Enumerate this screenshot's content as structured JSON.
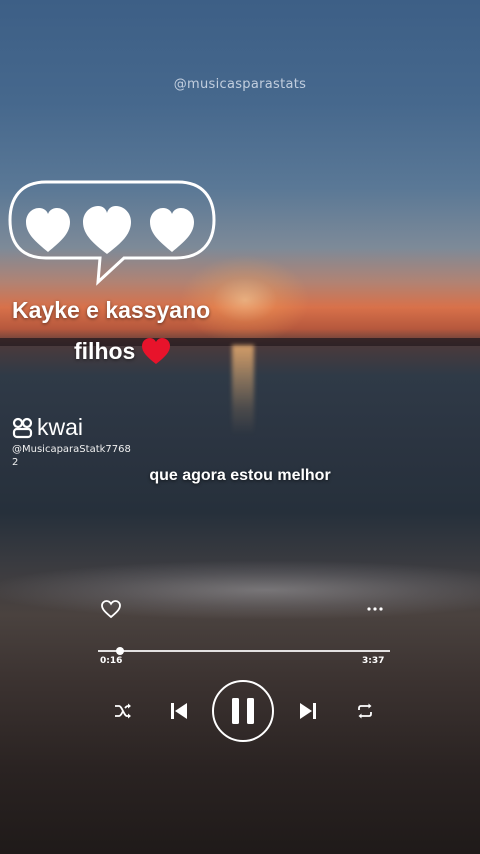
{
  "watermark": "@musicasparastats",
  "overlay": {
    "caption_line1": "Kayke e kassyano",
    "caption_line2": "filhos",
    "bubble_hearts": 3
  },
  "branding": {
    "logo_text": "kwai",
    "handle": "@MusicaparaStatk77682"
  },
  "lyric": "que agora estou melhor",
  "player": {
    "current_time": "0:16",
    "total_time": "3:37",
    "progress": 0.074,
    "state": "playing"
  },
  "icons": [
    "heart-icon",
    "more-icon",
    "shuffle-icon",
    "previous-icon",
    "pause-icon",
    "next-icon",
    "repeat-icon"
  ],
  "colors": {
    "heart_red": "#e8132b",
    "text": "#ffffff"
  }
}
